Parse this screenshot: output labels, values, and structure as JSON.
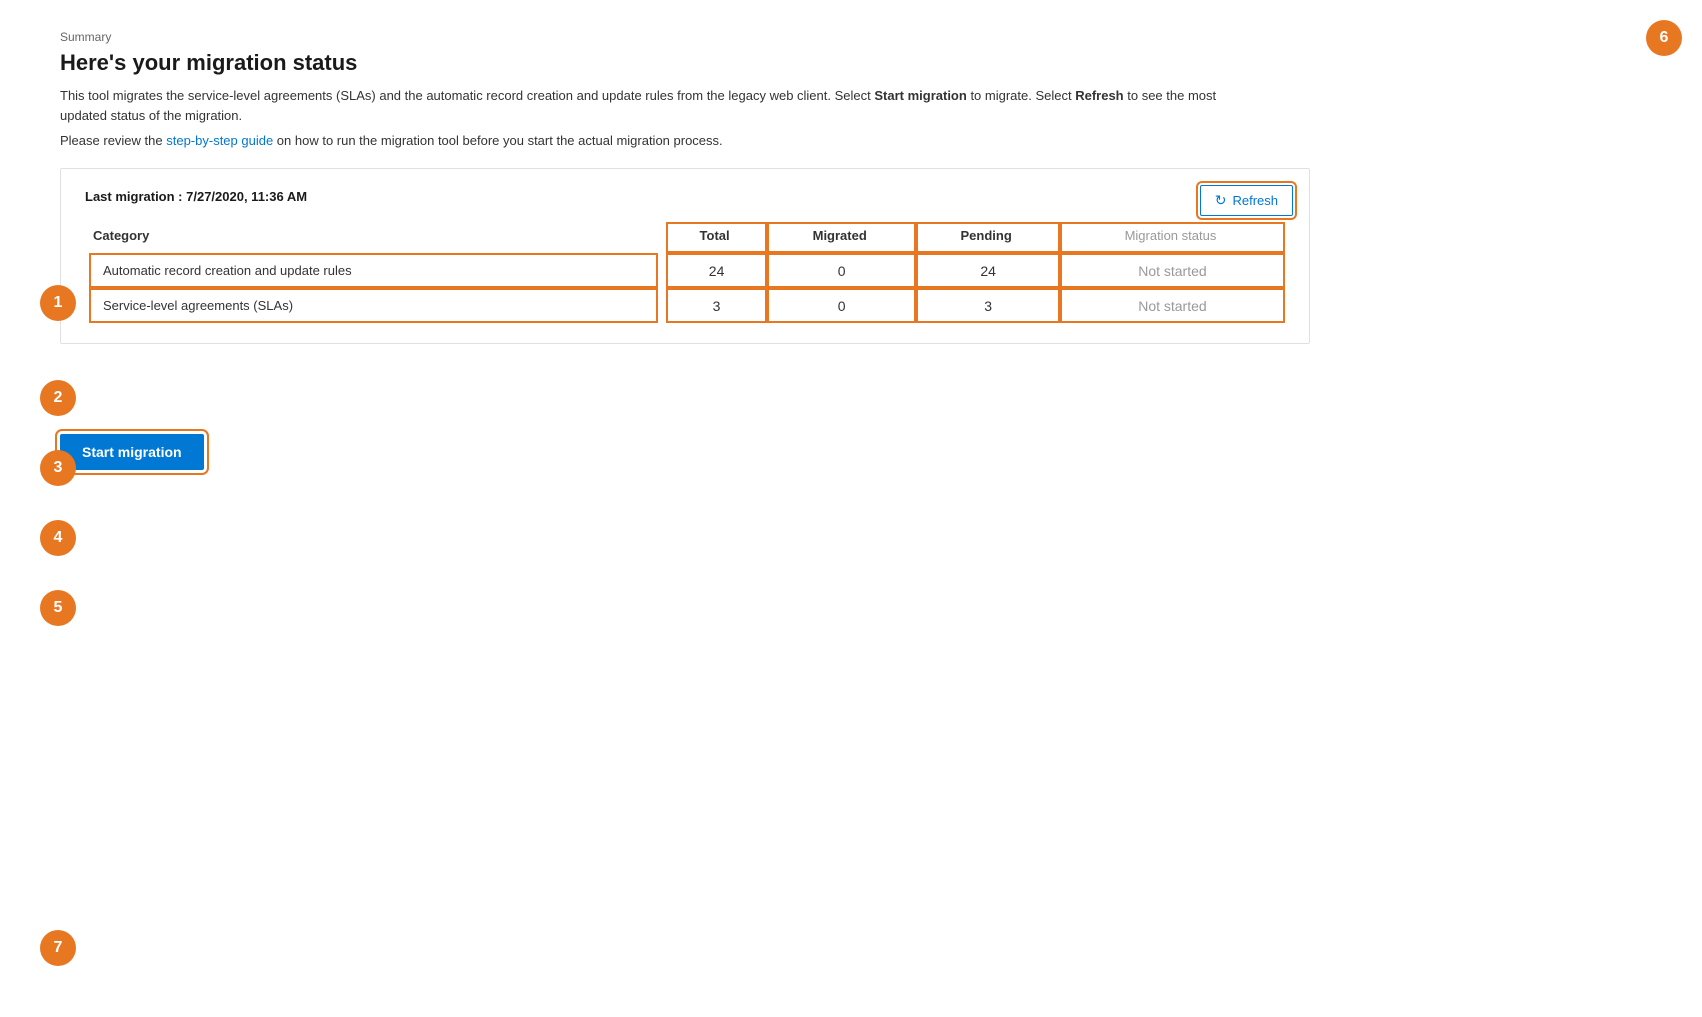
{
  "page": {
    "summary_label": "Summary",
    "title": "Here's your migration status",
    "description": "This tool migrates the service-level agreements (SLAs) and the automatic record creation and update rules from the legacy web client. Select ",
    "description_bold1": "Start migration",
    "description_mid": " to migrate. Select ",
    "description_bold2": "Refresh",
    "description_end": " to see the most updated status of the migration.",
    "guide_text_before": "Please review the ",
    "guide_link": "step-by-step guide",
    "guide_text_after": " on how to run the migration tool before you start the actual migration process.",
    "last_migration": "Last migration : 7/27/2020, 11:36 AM"
  },
  "refresh_button": {
    "label": "Refresh",
    "icon": "↻"
  },
  "table": {
    "headers": {
      "category": "Category",
      "total": "Total",
      "migrated": "Migrated",
      "pending": "Pending",
      "status": "Migration status"
    },
    "rows": [
      {
        "category": "Automatic record creation and update rules",
        "total": "24",
        "migrated": "0",
        "pending": "24",
        "status": "Not started"
      },
      {
        "category": "Service-level agreements (SLAs)",
        "total": "3",
        "migrated": "0",
        "pending": "3",
        "status": "Not started"
      }
    ]
  },
  "start_migration_button": {
    "label": "Start migration"
  },
  "annotations": {
    "numbers": [
      "1",
      "2",
      "3",
      "4",
      "5",
      "6",
      "7"
    ]
  }
}
